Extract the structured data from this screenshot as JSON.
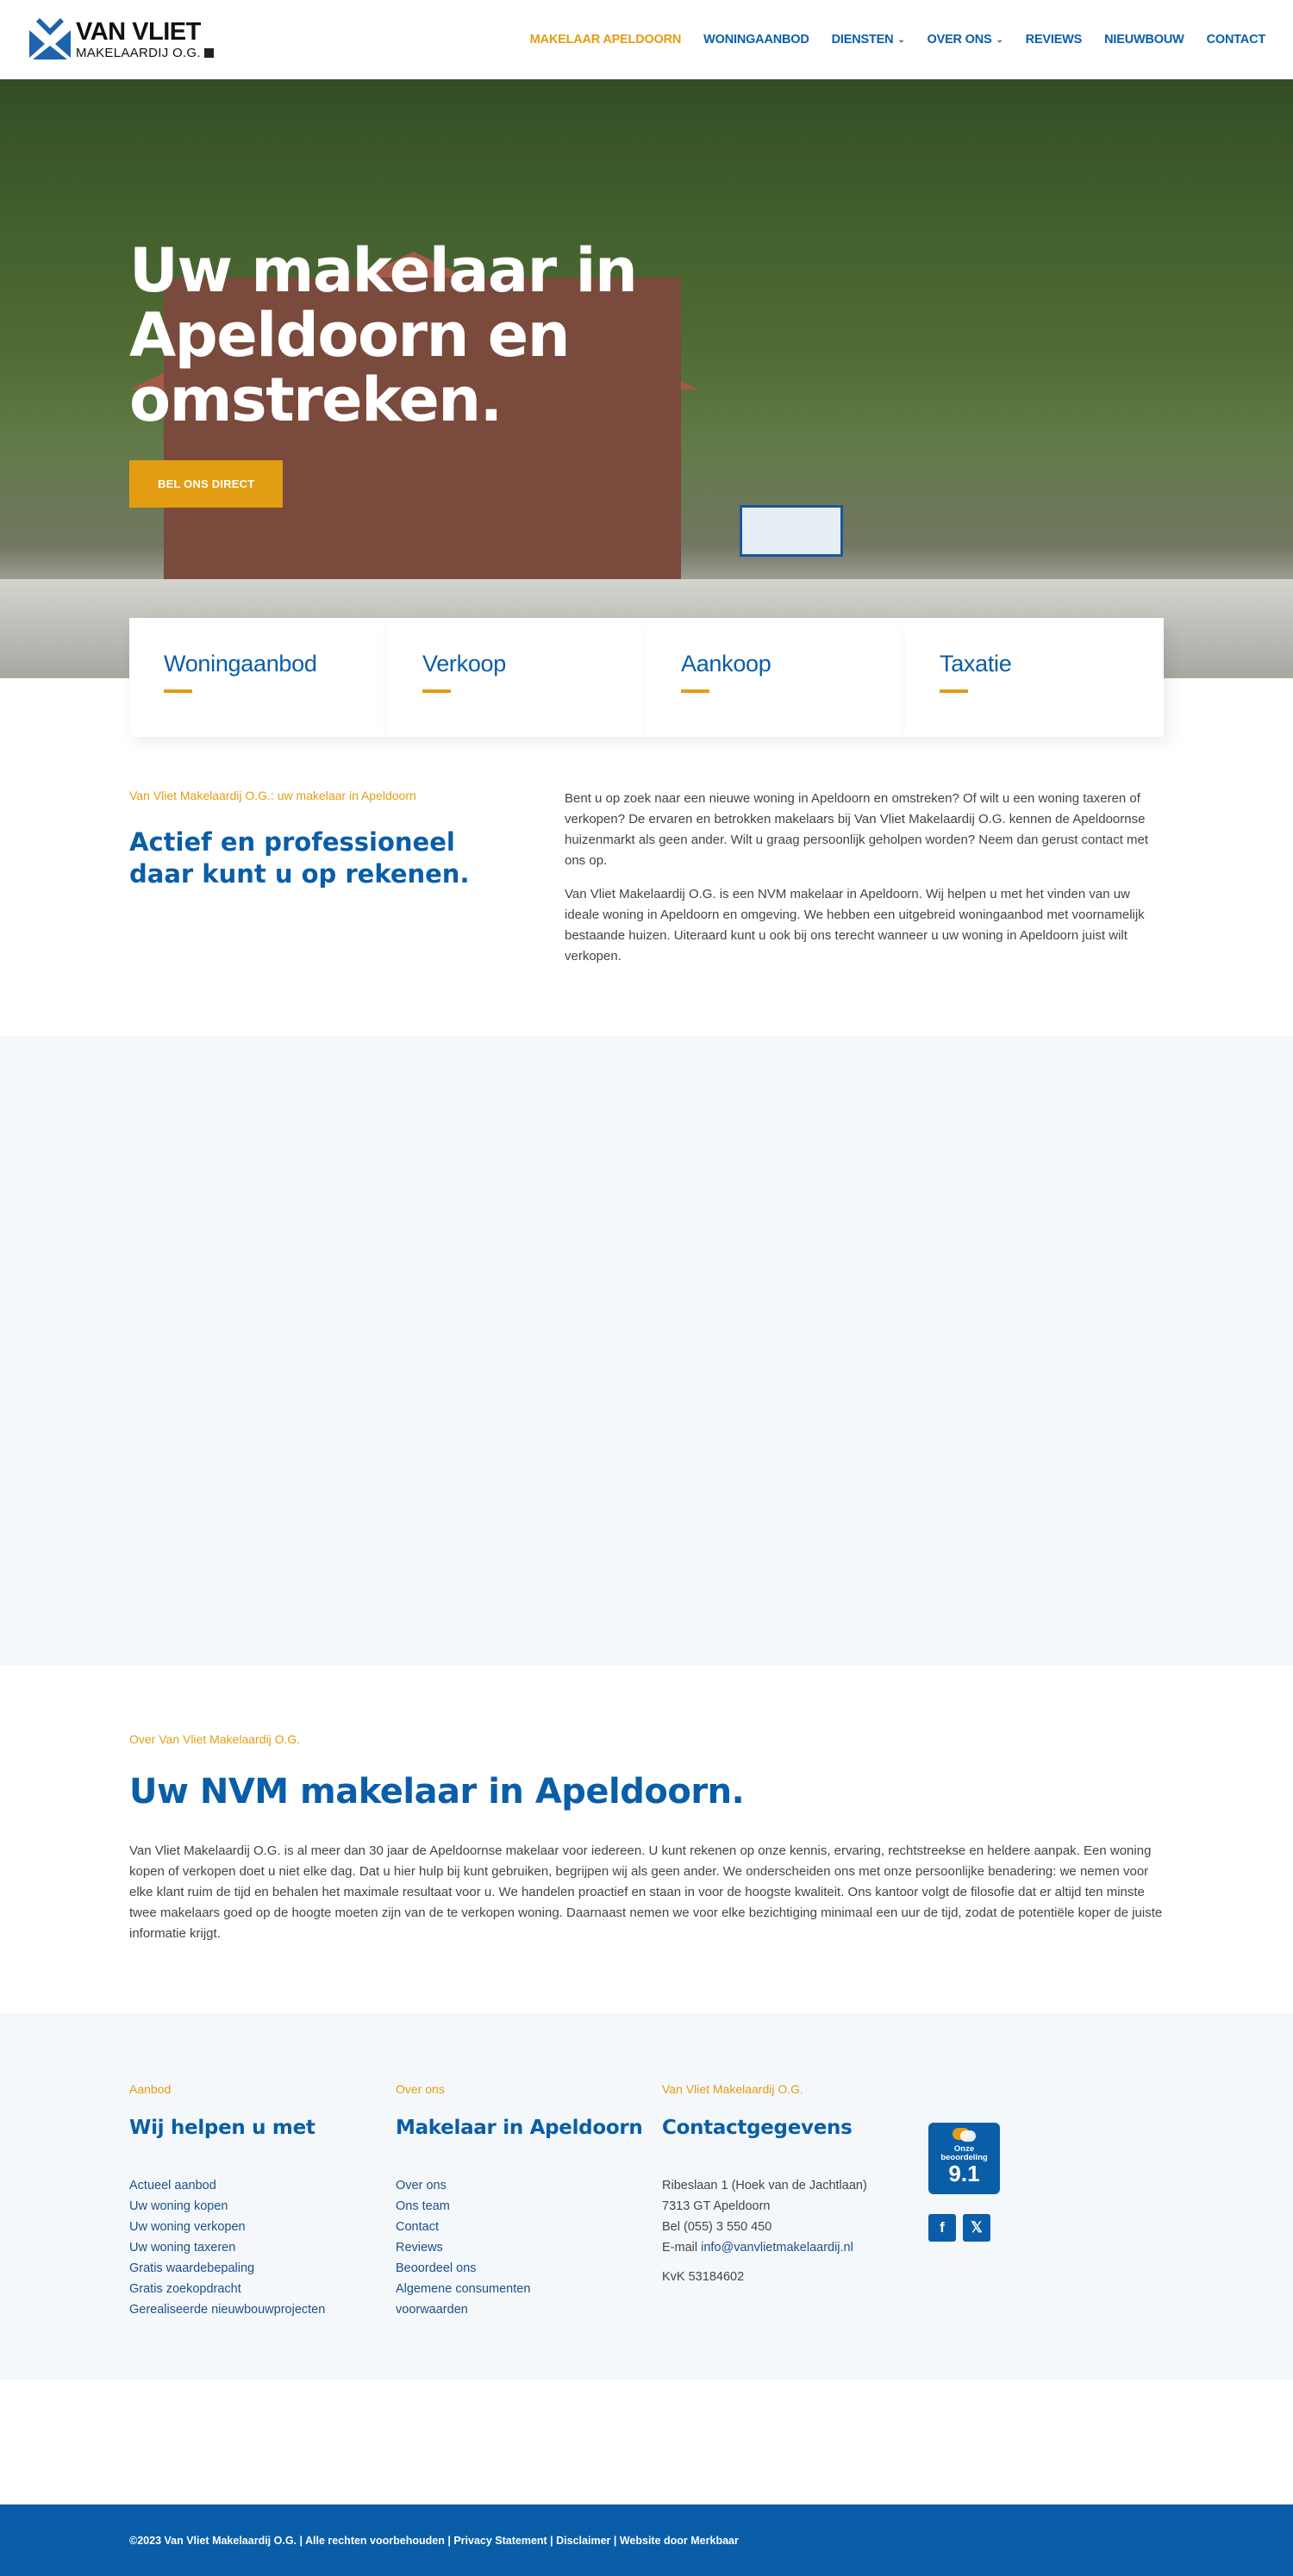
{
  "header": {
    "logo": {
      "name": "VAN VLIET",
      "subtitle": "MAKELAARDIJ O.G.",
      "icon": "vanvliet-logo-icon"
    },
    "nav": [
      {
        "label": "MAKELAAR APELDOORN",
        "active": true,
        "dropdown": false
      },
      {
        "label": "WONINGAANBOD",
        "active": false,
        "dropdown": false
      },
      {
        "label": "DIENSTEN",
        "active": false,
        "dropdown": true
      },
      {
        "label": "OVER ONS",
        "active": false,
        "dropdown": true
      },
      {
        "label": "REVIEWS",
        "active": false,
        "dropdown": false
      },
      {
        "label": "NIEUWBOUW",
        "active": false,
        "dropdown": false
      },
      {
        "label": "CONTACT",
        "active": false,
        "dropdown": false
      }
    ],
    "chevron": "⌄"
  },
  "hero": {
    "title": "Uw makelaar in Apeldoorn en omstreken.",
    "button_label": "BEL ONS DIRECT"
  },
  "cards": [
    {
      "title": "Woningaanbod"
    },
    {
      "title": "Verkoop"
    },
    {
      "title": "Aankoop"
    },
    {
      "title": "Taxatie"
    }
  ],
  "intro": {
    "eyebrow": "Van Vliet Makelaardij O.G.: uw makelaar in Apeldoorn",
    "heading": "Actief en professioneel daar kunt u op rekenen.",
    "paragraphs": [
      "Bent u op zoek naar een nieuwe woning in Apeldoorn en omstreken? Of wilt u een woning taxeren of verkopen? De ervaren en betrokken makelaars bij Van Vliet Makelaardij O.G. kennen de Apeldoornse huizenmarkt als geen ander. Wilt u graag persoonlijk geholpen worden? Neem dan gerust contact met ons op.",
      "Van Vliet Makelaardij O.G. is een NVM makelaar in Apeldoorn. Wij helpen u met het vinden van uw ideale woning in Apeldoorn en omgeving. We hebben een uitgebreid woningaanbod met voornamelijk bestaande huizen. Uiteraard kunt u ook bij ons terecht wanneer u uw woning in Apeldoorn juist wilt verkopen."
    ]
  },
  "about": {
    "eyebrow": "Over Van Vliet Makelaardij O.G.",
    "heading": "Uw NVM makelaar in Apeldoorn.",
    "text": "Van Vliet Makelaardij O.G. is al meer dan 30 jaar de Apeldoornse makelaar voor iedereen. U kunt rekenen op onze kennis, ervaring, rechtstreekse en heldere aanpak. Een woning kopen of verkopen doet u niet elke dag. Dat u hier hulp bij kunt gebruiken, begrijpen wij als geen ander. We onderscheiden ons met onze persoonlijke benadering: we nemen voor elke klant ruim de tijd en behalen het maximale resultaat voor u. We handelen proactief en staan in voor de hoogste kwaliteit. Ons kantoor volgt de filosofie dat er altijd ten minste twee makelaars goed op de hoogte moeten zijn van de te verkopen woning. Daarnaast nemen we voor elke bezichtiging minimaal een uur de tijd, zodat de potentiële koper de juiste informatie krijgt."
  },
  "footer": {
    "col1": {
      "eyebrow": "Aanbod",
      "heading": "Wij helpen u met",
      "links": [
        "Actueel aanbod",
        "Uw woning kopen",
        "Uw woning verkopen",
        "Uw woning taxeren",
        "Gratis waardebepaling",
        "Gratis zoekopdracht",
        "Gerealiseerde nieuwbouwprojecten"
      ]
    },
    "col2": {
      "eyebrow": "Over ons",
      "heading": "Makelaar in Apeldoorn",
      "links": [
        "Over ons",
        "Ons team",
        "Contact",
        "Reviews",
        "Beoordeel ons",
        "Algemene consumenten voorwaarden"
      ]
    },
    "col3": {
      "eyebrow": "Van Vliet Makelaardij O.G.",
      "heading": "Contactgegevens",
      "address": "Ribeslaan 1 (Hoek van de Jachtlaan)",
      "city": "7313 GT Apeldoorn",
      "phone": "Bel (055) 3 550 450",
      "email_prefix": "E-mail ",
      "email": "info@vanvlietmakelaardij.nl",
      "kvk": "KvK 53184602"
    },
    "rating": {
      "label_line1": "Onze",
      "label_line2": "beoordeling",
      "score": "9.1"
    },
    "socials": [
      {
        "name": "facebook-icon",
        "glyph": "f"
      },
      {
        "name": "x-twitter-icon",
        "glyph": "𝕏"
      }
    ]
  },
  "bottom_bar": {
    "copyright": "©2023 Van Vliet Makelaardij O.G.",
    "rights": "Alle rechten voorbehouden",
    "privacy": "Privacy Statement",
    "disclaimer": "Disclaimer",
    "credit": "Website door Merkbaar",
    "separator": " | "
  },
  "colors": {
    "brand_blue": "#0a5ea8",
    "accent_gold": "#e29d12",
    "light_bg": "#f4f8fb",
    "text": "#444444"
  }
}
